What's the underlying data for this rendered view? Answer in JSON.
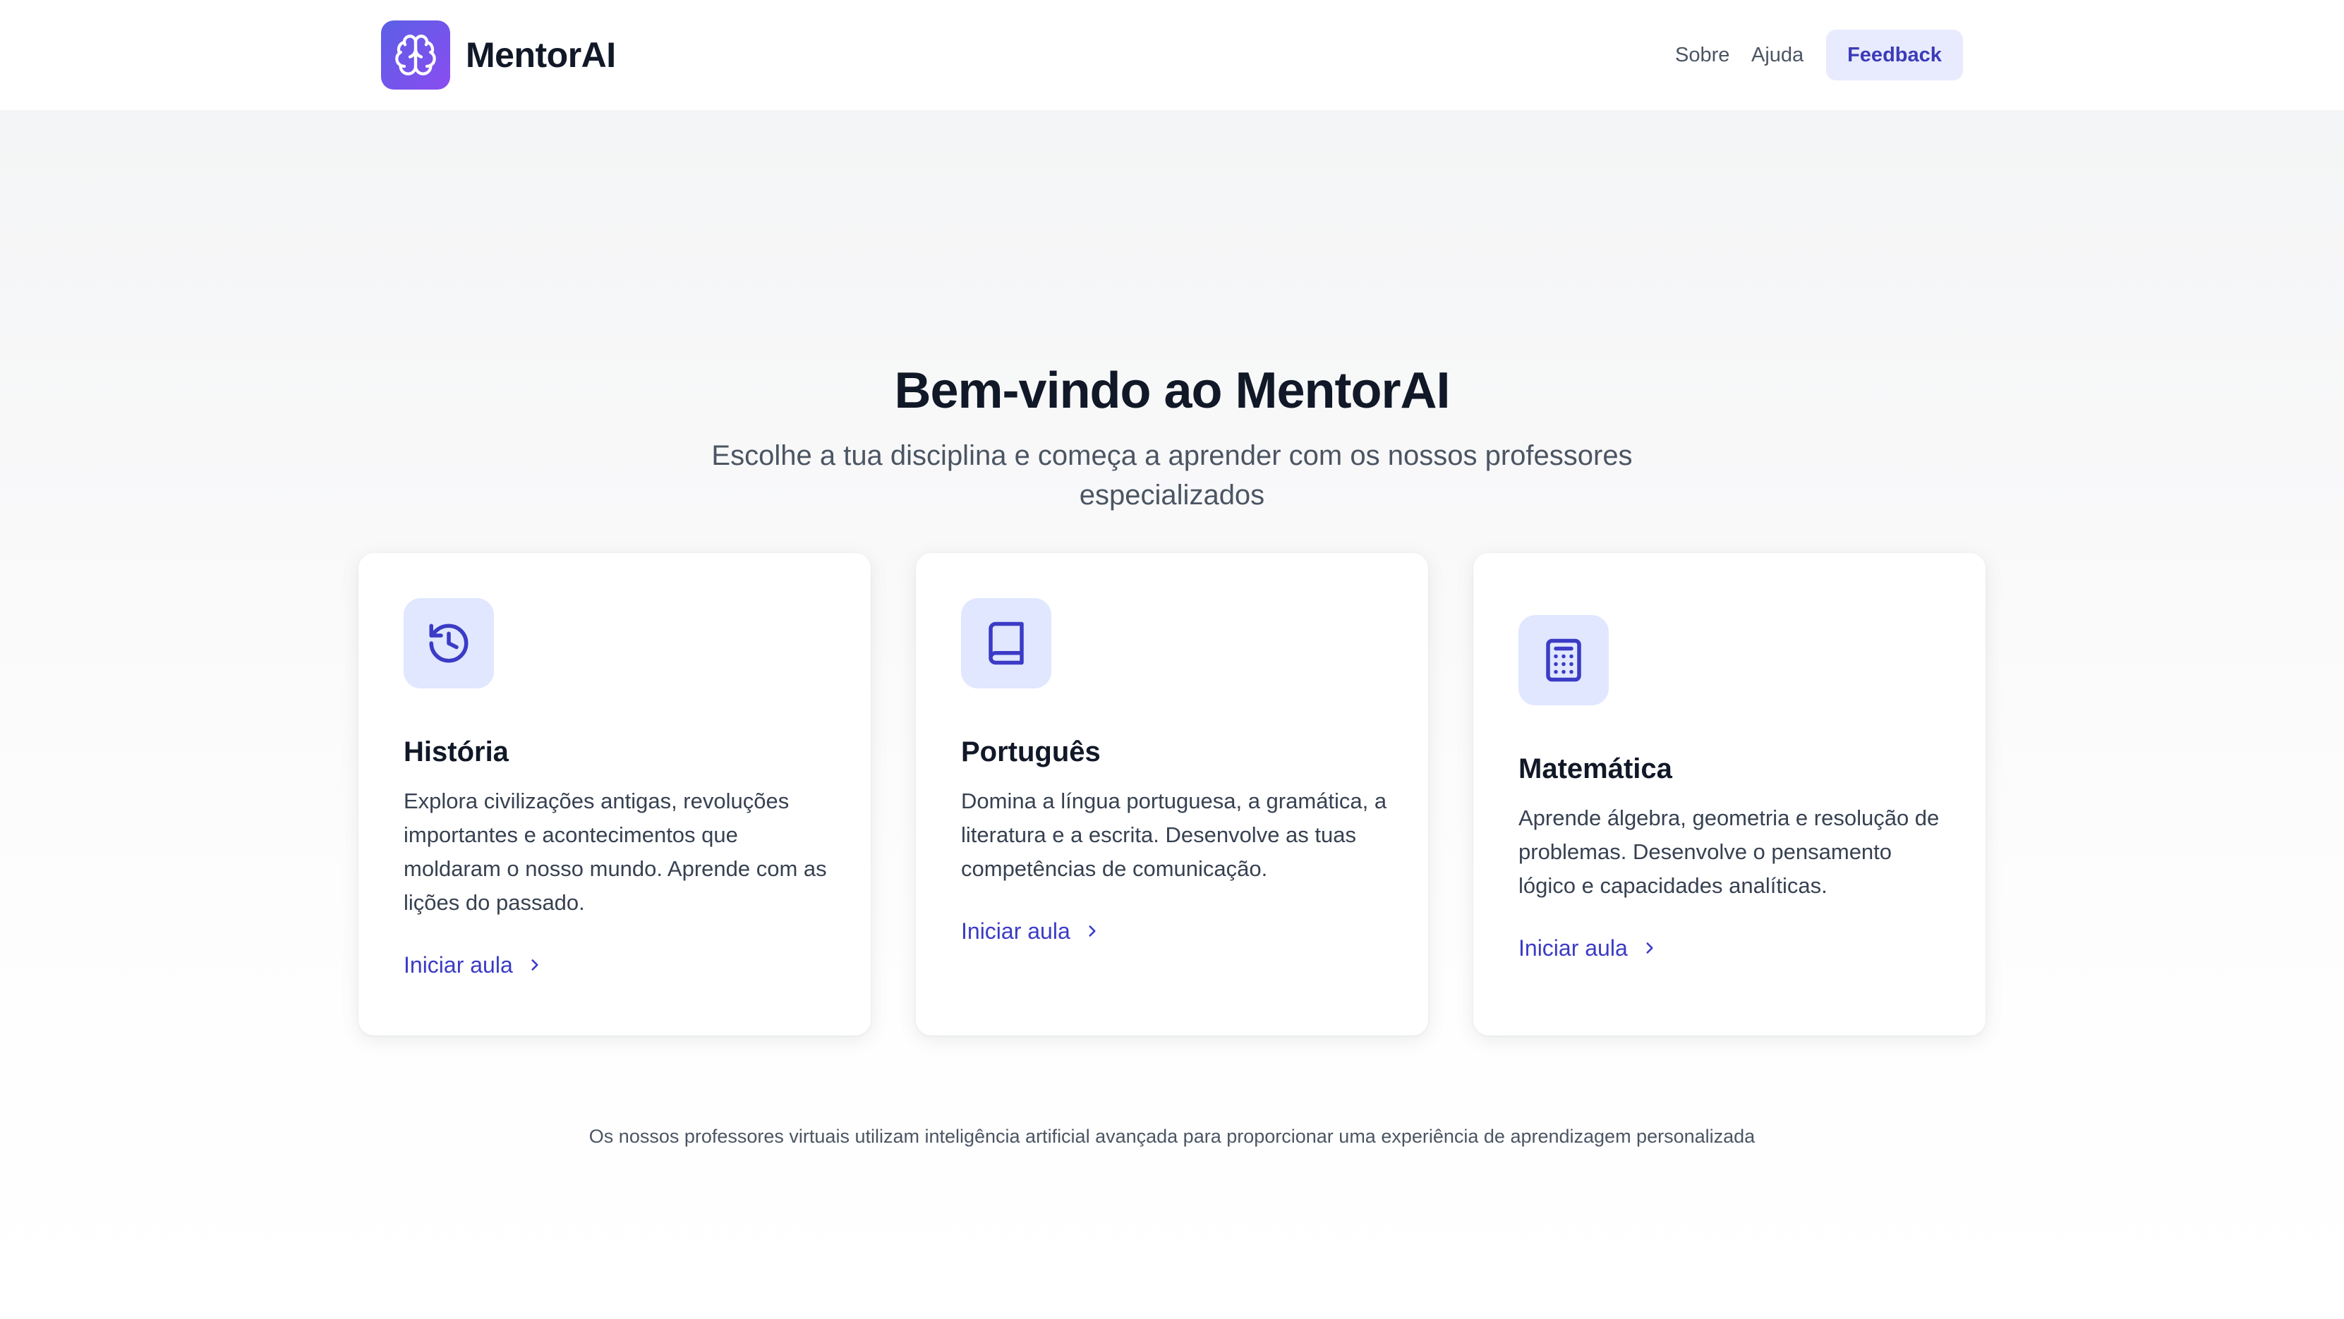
{
  "header": {
    "brand": "MentorAI",
    "logo_icon": "brain-icon",
    "nav": [
      {
        "label": "Sobre"
      },
      {
        "label": "Ajuda"
      }
    ],
    "feedback_label": "Feedback"
  },
  "hero": {
    "title": "Bem-vindo ao MentorAI",
    "subtitle": "Escolhe a tua disciplina e começa a aprender com os nossos professores especializados"
  },
  "subjects": [
    {
      "title": "História",
      "icon": "history-icon",
      "description": "Explora civilizações antigas, revoluções importantes e acontecimentos que moldaram o nosso mundo. Aprende com as lições do passado.",
      "cta": "Iniciar aula"
    },
    {
      "title": "Português",
      "icon": "book-icon",
      "description": "Domina a língua portuguesa, a gramática, a literatura e a escrita. Desenvolve as tuas competências de comunicação.",
      "cta": "Iniciar aula"
    },
    {
      "title": "Matemática",
      "icon": "calculator-icon",
      "description": "Aprende álgebra, geometria e resolução de problemas. Desenvolve o pensamento lógico e capacidades analíticas.",
      "cta": "Iniciar aula"
    }
  ],
  "footer_note": "Os nossos professores virtuais utilizam inteligência artificial avançada para proporcionar uma experiência de aprendizagem personalizada",
  "colors": {
    "accent": "#3b3bc6",
    "icon_tile": "#e0e7ff",
    "logo_gradient_start": "#5b5fe6",
    "logo_gradient_end": "#8a4df0",
    "feedback_bg": "#e8ebfd"
  }
}
